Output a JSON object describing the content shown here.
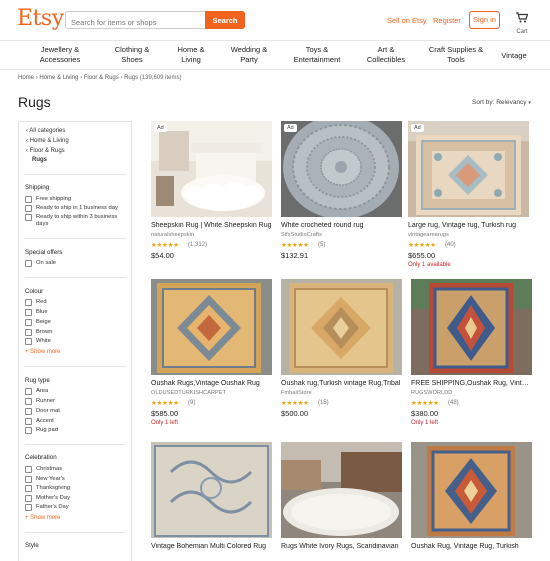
{
  "header": {
    "logo": "Etsy",
    "search_placeholder": "Search for items or shops",
    "search_button": "Search",
    "sell": "Sell on Etsy",
    "register": "Register",
    "signin": "Sign in",
    "cart": "Cart",
    "accent": "#f1641e"
  },
  "nav": [
    {
      "l1": "Jewellery &",
      "l2": "Accessories"
    },
    {
      "l1": "Clothing &",
      "l2": "Shoes"
    },
    {
      "l1": "Home &",
      "l2": "Living"
    },
    {
      "l1": "Wedding &",
      "l2": "Party"
    },
    {
      "l1": "Toys &",
      "l2": "Entertainment"
    },
    {
      "l1": "Art &",
      "l2": "Collectibles"
    },
    {
      "l1": "Craft Supplies &",
      "l2": "Tools"
    },
    {
      "l1": "Vintage",
      "l2": ""
    }
  ],
  "breadcrumb": {
    "items": [
      "Home",
      "Home & Living",
      "Floor & Rugs",
      "Rugs"
    ],
    "count": "(139,609 items)",
    "sep": "›"
  },
  "page": {
    "title": "Rugs",
    "sort": "Sort by: Relevancy"
  },
  "sidebar": {
    "categories": [
      "All categories",
      "Home & Living",
      "Floor & Rugs",
      "Rugs"
    ],
    "shipping": {
      "title": "Shipping",
      "options": [
        "Free shipping",
        "Ready to ship in 1 business day",
        "Ready to ship within 3 business days"
      ]
    },
    "offers": {
      "title": "Special offers",
      "options": [
        "On sale"
      ]
    },
    "colour": {
      "title": "Colour",
      "options": [
        "Red",
        "Blue",
        "Beige",
        "Brown",
        "White"
      ],
      "more": "+ Show more"
    },
    "rugtype": {
      "title": "Rug type",
      "options": [
        "Area",
        "Runner",
        "Door mat",
        "Accent",
        "Rug pad"
      ]
    },
    "celebration": {
      "title": "Celebration",
      "options": [
        "Christmas",
        "New Year's",
        "Thanksgiving",
        "Mother's Day",
        "Father's Day"
      ],
      "more": "+ Show more"
    },
    "style": {
      "title": "Style"
    }
  },
  "listings": [
    {
      "ad": "Ad",
      "title": "Sheepskin Rug | White Sheepskin Rug",
      "shop": "naturalsheepskin",
      "stars": "★★★★★",
      "reviews": "(1,312)",
      "price": "$54.00",
      "note": ""
    },
    {
      "ad": "Ad",
      "title": "White crocheted round rug",
      "shop": "SifsStudioCrafts",
      "stars": "★★★★★",
      "reviews": "(5)",
      "price": "$132.91",
      "note": ""
    },
    {
      "ad": "Ad",
      "title": "Large rug, Vintage rug, Turkish rug",
      "shop": "vintagearearugs",
      "stars": "★★★★★",
      "reviews": "(40)",
      "price": "$655.00",
      "note": "Only 1 available"
    },
    {
      "ad": "",
      "title": "Oushak Rugs,Vintage Oushak Rug",
      "shop": "OLDUSEDTURKISHCARPET",
      "stars": "★★★★★",
      "reviews": "(9)",
      "price": "$585.00",
      "note": "Only 1 left"
    },
    {
      "ad": "",
      "title": "Oushak rug,Turkish vintage Rug,Tribal",
      "shop": "FmhaliStore",
      "stars": "★★★★★",
      "reviews": "(15)",
      "price": "$500.00",
      "note": ""
    },
    {
      "ad": "",
      "title": "FREE SHIPPING,Oushak Rug, Vintage",
      "shop": "RUGSWORLDD",
      "stars": "★★★★★",
      "reviews": "(48)",
      "price": "$380.00",
      "note": "Only 1 left"
    },
    {
      "ad": "",
      "title": "Vintage Bohemian Multi Colored Rug",
      "shop": "",
      "stars": "",
      "reviews": "",
      "price": "",
      "note": ""
    },
    {
      "ad": "",
      "title": "Rugs White Ivory Rugs, Scandinavian",
      "shop": "",
      "stars": "",
      "reviews": "",
      "price": "",
      "note": ""
    },
    {
      "ad": "",
      "title": "Oushak Rug, Vintage Rug, Turkish",
      "shop": "",
      "stars": "",
      "reviews": "",
      "price": "",
      "note": ""
    }
  ]
}
